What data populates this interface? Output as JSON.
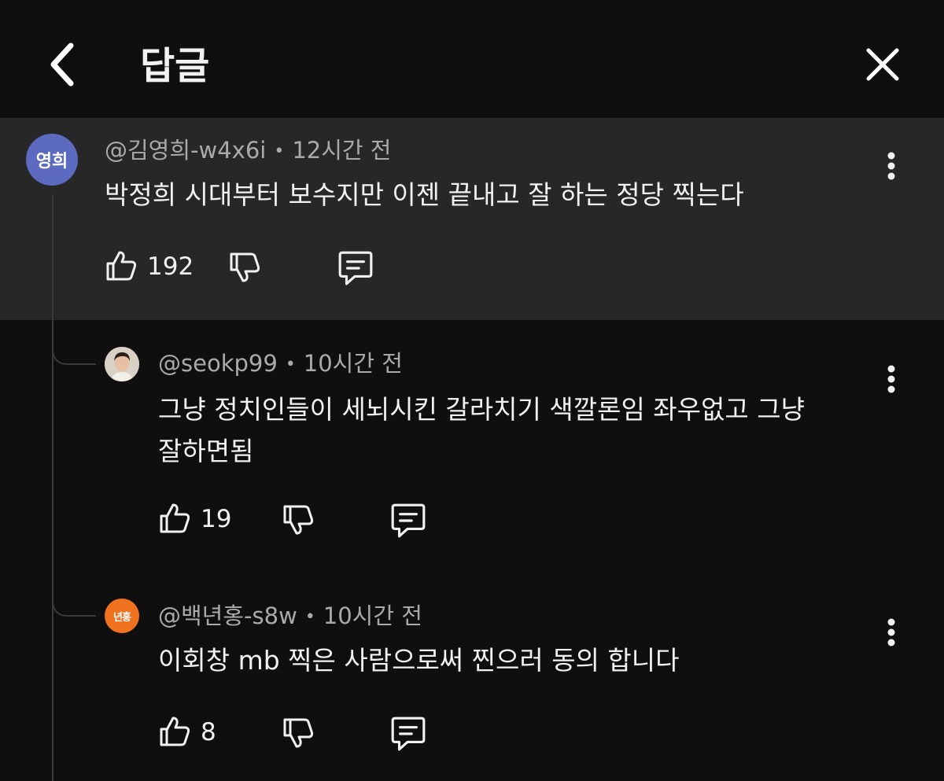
{
  "header": {
    "title": "답글",
    "back_icon": "chevron-left-icon",
    "close_icon": "close-icon"
  },
  "parent_comment": {
    "avatar_text": "영희",
    "avatar_color": "#5c6bc0",
    "author": "@김영희-w4x6i",
    "time": "12시간 전",
    "text": "박정희 시대부터 보수지만 이젠 끝내고 잘 하는 정당 찍는다",
    "likes": "192"
  },
  "replies": [
    {
      "author": "@seokp99",
      "time": "10시간 전",
      "text_line1": "그냥 정치인들이 세뇌시킨 갈라치기 색깔론임 좌우없고 그냥",
      "text_line2": "잘하면됨",
      "likes": "19"
    },
    {
      "avatar_text": "년홍",
      "avatar_color": "#f0711e",
      "author": "@백년홍-s8w",
      "time": "10시간 전",
      "text": "이회창 mb 찍은 사람으로써 찐으러 동의 합니다",
      "likes": "8"
    }
  ],
  "colors": {
    "background": "#0f0f0f",
    "highlight": "#272727",
    "meta_text": "#aaaaaa",
    "primary_text": "#f1f1f1"
  }
}
